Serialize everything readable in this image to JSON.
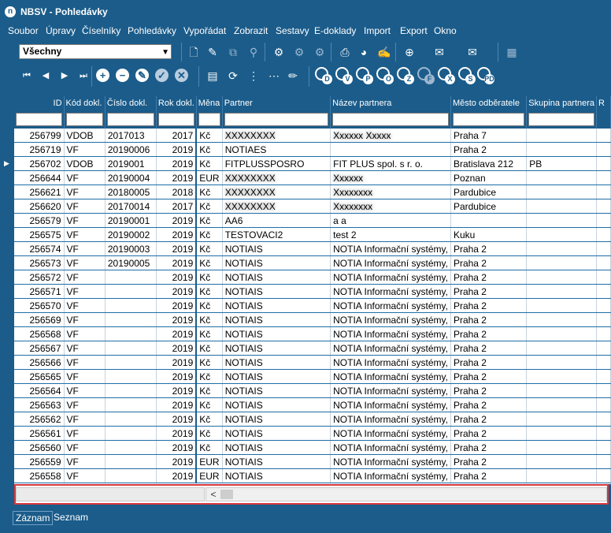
{
  "window": {
    "title": "NBSV - Pohledávky",
    "icon": "app-logo-icon"
  },
  "menu": [
    "Soubor",
    "Úpravy",
    "Číselníky",
    "Pohledávky",
    "Vypořádat",
    "Zobrazit",
    "Sestavy",
    "E-doklady",
    "Import",
    "Export",
    "Okno"
  ],
  "filter_select": {
    "value": "Všechny"
  },
  "toolbar1_icons": [
    "new-document-icon",
    "edit-document-icon",
    "copy-document-icon",
    "stamp-icon",
    "network-icon",
    "network-disabled-icon",
    "network-tree-icon",
    "print-icon",
    "pie-chart-icon",
    "notes-icon",
    "add-attach-icon",
    "mail-icon",
    "mail-send-icon",
    "calendar-icon"
  ],
  "nav_icons": [
    "first-record-icon",
    "prev-record-icon",
    "next-record-icon",
    "last-record-icon",
    "add-record-icon",
    "delete-record-icon",
    "edit-record-icon",
    "confirm-icon",
    "cancel-icon"
  ],
  "toolbar2_icons": [
    "report-icon",
    "refresh-icon",
    "grid-select-icon",
    "grid-mark-icon",
    "pencil-icon"
  ],
  "letter_filters": [
    "D",
    "V",
    "P",
    "O",
    "Z",
    "F",
    "X",
    "S",
    "PD"
  ],
  "columns": [
    "ID",
    "Kód dokl.",
    "Číslo dokl.",
    "Rok dokl.",
    "Měna",
    "Partner",
    "Název partnera",
    "Město odběratele",
    "Skupina partnera",
    "R"
  ],
  "rows": [
    {
      "id": "256799",
      "kod": "VDOB",
      "cislo": "2017013",
      "rok": "2017",
      "mena": "Kč",
      "partner": "XXXXXXXX",
      "nazev": "Xxxxxx Xxxxx",
      "mesto": "Praha 7",
      "skupina": ""
    },
    {
      "id": "256719",
      "kod": "VF",
      "cislo": "20190006",
      "rok": "2019",
      "mena": "Kč",
      "partner": "NOTIAES",
      "nazev": "",
      "mesto": "Praha 2",
      "skupina": ""
    },
    {
      "id": "256702",
      "kod": "VDOB",
      "cislo": "2019001",
      "rok": "2019",
      "mena": "Kč",
      "partner": "FITPLUSSPOSRO",
      "nazev": "FIT PLUS spol. s r. o.",
      "mesto": "Bratislava 212",
      "skupina": "PB"
    },
    {
      "id": "256644",
      "kod": "VF",
      "cislo": "20190004",
      "rok": "2019",
      "mena": "EUR",
      "partner": "XXXXXXXX",
      "nazev": "Xxxxxx",
      "mesto": "Poznan",
      "skupina": ""
    },
    {
      "id": "256621",
      "kod": "VF",
      "cislo": "20180005",
      "rok": "2018",
      "mena": "Kč",
      "partner": "XXXXXXXX",
      "nazev": "Xxxxxxxx",
      "mesto": "Pardubice",
      "skupina": ""
    },
    {
      "id": "256620",
      "kod": "VF",
      "cislo": "20170014",
      "rok": "2017",
      "mena": "Kč",
      "partner": "XXXXXXXX",
      "nazev": "Xxxxxxxx",
      "mesto": "Pardubice",
      "skupina": ""
    },
    {
      "id": "256579",
      "kod": "VF",
      "cislo": "20190001",
      "rok": "2019",
      "mena": "Kč",
      "partner": "AA6",
      "nazev": "a a",
      "mesto": "",
      "skupina": ""
    },
    {
      "id": "256575",
      "kod": "VF",
      "cislo": "20190002",
      "rok": "2019",
      "mena": "Kč",
      "partner": "TESTOVACI2",
      "nazev": "test 2",
      "mesto": "Kuku",
      "skupina": ""
    },
    {
      "id": "256574",
      "kod": "VF",
      "cislo": "20190003",
      "rok": "2019",
      "mena": "Kč",
      "partner": "NOTIAIS",
      "nazev": "NOTIA Informační systémy,",
      "mesto": "Praha 2",
      "skupina": ""
    },
    {
      "id": "256573",
      "kod": "VF",
      "cislo": "20190005",
      "rok": "2019",
      "mena": "Kč",
      "partner": "NOTIAIS",
      "nazev": "NOTIA Informační systémy,",
      "mesto": "Praha 2",
      "skupina": ""
    },
    {
      "id": "256572",
      "kod": "VF",
      "cislo": "",
      "rok": "2019",
      "mena": "Kč",
      "partner": "NOTIAIS",
      "nazev": "NOTIA Informační systémy,",
      "mesto": "Praha 2",
      "skupina": ""
    },
    {
      "id": "256571",
      "kod": "VF",
      "cislo": "",
      "rok": "2019",
      "mena": "Kč",
      "partner": "NOTIAIS",
      "nazev": "NOTIA Informační systémy,",
      "mesto": "Praha 2",
      "skupina": ""
    },
    {
      "id": "256570",
      "kod": "VF",
      "cislo": "",
      "rok": "2019",
      "mena": "Kč",
      "partner": "NOTIAIS",
      "nazev": "NOTIA Informační systémy,",
      "mesto": "Praha 2",
      "skupina": ""
    },
    {
      "id": "256569",
      "kod": "VF",
      "cislo": "",
      "rok": "2019",
      "mena": "Kč",
      "partner": "NOTIAIS",
      "nazev": "NOTIA Informační systémy,",
      "mesto": "Praha 2",
      "skupina": ""
    },
    {
      "id": "256568",
      "kod": "VF",
      "cislo": "",
      "rok": "2019",
      "mena": "Kč",
      "partner": "NOTIAIS",
      "nazev": "NOTIA Informační systémy,",
      "mesto": "Praha 2",
      "skupina": ""
    },
    {
      "id": "256567",
      "kod": "VF",
      "cislo": "",
      "rok": "2019",
      "mena": "Kč",
      "partner": "NOTIAIS",
      "nazev": "NOTIA Informační systémy,",
      "mesto": "Praha 2",
      "skupina": ""
    },
    {
      "id": "256566",
      "kod": "VF",
      "cislo": "",
      "rok": "2019",
      "mena": "Kč",
      "partner": "NOTIAIS",
      "nazev": "NOTIA Informační systémy,",
      "mesto": "Praha 2",
      "skupina": ""
    },
    {
      "id": "256565",
      "kod": "VF",
      "cislo": "",
      "rok": "2019",
      "mena": "Kč",
      "partner": "NOTIAIS",
      "nazev": "NOTIA Informační systémy,",
      "mesto": "Praha 2",
      "skupina": ""
    },
    {
      "id": "256564",
      "kod": "VF",
      "cislo": "",
      "rok": "2019",
      "mena": "Kč",
      "partner": "NOTIAIS",
      "nazev": "NOTIA Informační systémy,",
      "mesto": "Praha 2",
      "skupina": ""
    },
    {
      "id": "256563",
      "kod": "VF",
      "cislo": "",
      "rok": "2019",
      "mena": "Kč",
      "partner": "NOTIAIS",
      "nazev": "NOTIA Informační systémy,",
      "mesto": "Praha 2",
      "skupina": ""
    },
    {
      "id": "256562",
      "kod": "VF",
      "cislo": "",
      "rok": "2019",
      "mena": "Kč",
      "partner": "NOTIAIS",
      "nazev": "NOTIA Informační systémy,",
      "mesto": "Praha 2",
      "skupina": ""
    },
    {
      "id": "256561",
      "kod": "VF",
      "cislo": "",
      "rok": "2019",
      "mena": "Kč",
      "partner": "NOTIAIS",
      "nazev": "NOTIA Informační systémy,",
      "mesto": "Praha 2",
      "skupina": ""
    },
    {
      "id": "256560",
      "kod": "VF",
      "cislo": "",
      "rok": "2019",
      "mena": "Kč",
      "partner": "NOTIAIS",
      "nazev": "NOTIA Informační systémy,",
      "mesto": "Praha 2",
      "skupina": ""
    },
    {
      "id": "256559",
      "kod": "VF",
      "cislo": "",
      "rok": "2019",
      "mena": "EUR",
      "partner": "NOTIAIS",
      "nazev": "NOTIA Informační systémy,",
      "mesto": "Praha 2",
      "skupina": ""
    },
    {
      "id": "256558",
      "kod": "VF",
      "cislo": "",
      "rok": "2019",
      "mena": "EUR",
      "partner": "NOTIAIS",
      "nazev": "NOTIA Informační systémy,",
      "mesto": "Praha 2",
      "skupina": ""
    }
  ],
  "blurred_rows": [
    0,
    3,
    4,
    5
  ],
  "selected_row_index": 2,
  "tabs": [
    "Záznam",
    "Seznam"
  ],
  "active_tab": "Záznam",
  "scroll_left_glyph": "<",
  "colors": {
    "chrome": "#1b5c8a",
    "highlight_border": "#d9393f"
  }
}
